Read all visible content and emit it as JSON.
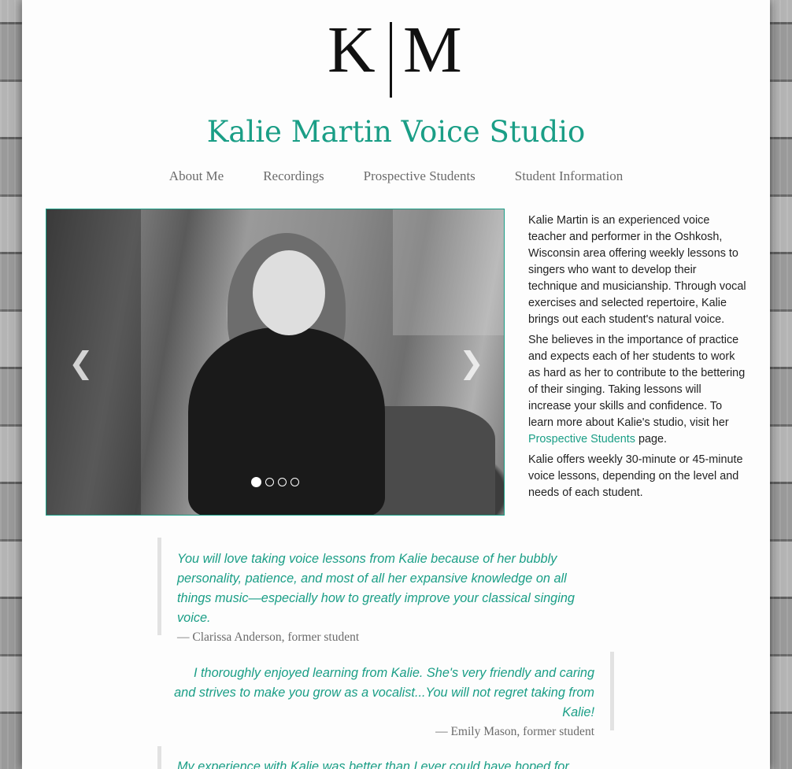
{
  "logo": {
    "letter_left": "K",
    "letter_right": "M"
  },
  "site": {
    "title": "Kalie Martin Voice Studio"
  },
  "nav": {
    "items": [
      {
        "label": "About Me"
      },
      {
        "label": "Recordings"
      },
      {
        "label": "Prospective Students"
      },
      {
        "label": "Student Information"
      }
    ]
  },
  "carousel": {
    "prev_icon": "chevron-left-icon",
    "next_icon": "chevron-right-icon",
    "prev_glyph": "❮",
    "next_glyph": "❯",
    "slide_count": 4,
    "active_index": 0
  },
  "intro": {
    "p1": "Kalie Martin is an experienced voice teacher and performer in the Oshkosh, Wisconsin area offering weekly lessons to singers who want to develop their technique and musicianship. Through vocal exercises and selected repertoire, Kalie brings out each student's natural voice.",
    "p2_before_link": "She believes in the importance of practice and expects each of her students to work as hard as her to contribute to the bettering of their singing. Taking lessons will increase your skills and confidence. To learn more about Kalie's studio, visit her ",
    "p2_link": "Prospective Students",
    "p2_after_link": " page.",
    "p3": "Kalie offers weekly 30-minute or 45-minute voice lessons, depending on the level and needs of each student."
  },
  "testimonials": [
    {
      "text": "You will love taking voice lessons from Kalie because of her bubbly personality, patience, and most of all her expansive knowledge on all things music—especially how to greatly improve your classical singing voice.",
      "author": "— Clarissa Anderson, former student"
    },
    {
      "text": "I thoroughly enjoyed learning from Kalie. She's very friendly and caring and strives to make you grow as a vocalist...You will not regret taking from Kalie!",
      "author": "— Emily Mason, former student"
    },
    {
      "text": "My experience with Kalie was better than I ever could have hoped for. She"
    }
  ],
  "colors": {
    "accent": "#1a9e86",
    "nav_text": "#6b6b6b"
  }
}
